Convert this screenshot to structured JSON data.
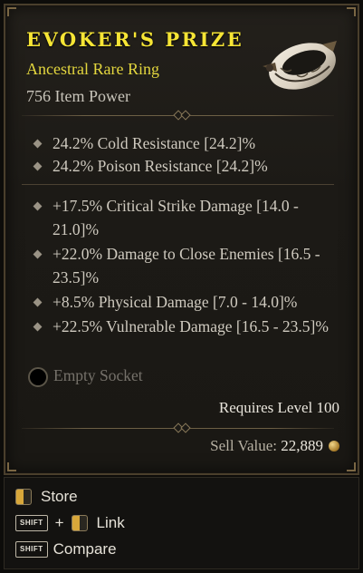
{
  "item": {
    "name": "EVOKER'S PRIZE",
    "type": "Ancestral Rare Ring",
    "power": "756 Item Power",
    "image": "ring-icon",
    "name_color": "#f6e535",
    "type_color": "#e3d63e"
  },
  "implicits": [
    {
      "text": "24.2% Cold Resistance [24.2]%"
    },
    {
      "text": "24.2% Poison Resistance [24.2]%"
    }
  ],
  "affixes": [
    {
      "text": "+17.5% Critical Strike Damage [14.0 - 21.0]%"
    },
    {
      "text": "+22.0% Damage to Close Enemies [16.5 - 23.5]%"
    },
    {
      "text": "+8.5% Physical Damage [7.0 - 14.0]%"
    },
    {
      "text": "+22.5% Vulnerable Damage [16.5 - 23.5]%"
    }
  ],
  "socket": {
    "label": "Empty Socket"
  },
  "requirements": {
    "level": "Requires Level 100"
  },
  "sell": {
    "label": "Sell Value:",
    "value": "22,889",
    "icon": "gold-coin-icon"
  },
  "hints": {
    "store": "Store",
    "link": "Link",
    "compare": "Compare",
    "shift": "SHIFT",
    "plus": "+"
  }
}
